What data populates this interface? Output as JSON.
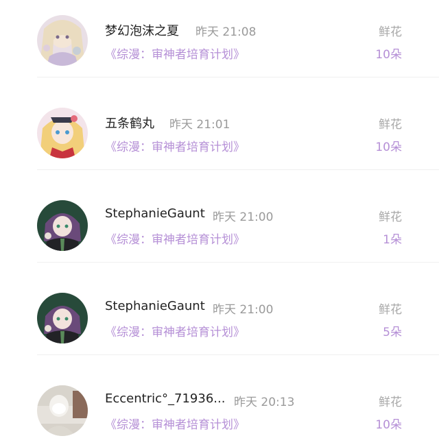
{
  "colors": {
    "name": "#222222",
    "time": "#9a9a9a",
    "accent_purple": "#b58fd6",
    "gift_label": "#a8a8a8",
    "divider": "#f0f0f0"
  },
  "records": [
    {
      "name": "梦幻泡沫之夏",
      "time": "昨天 21:08",
      "book": "《综漫：审神者培育计划》",
      "gift_label": "鲜花",
      "gift_count": "10朵",
      "avatar_icon": "anime-avatar-icon"
    },
    {
      "name": "五条鹤丸",
      "time": "昨天 21:01",
      "book": "《综漫：审神者培育计划》",
      "gift_label": "鲜花",
      "gift_count": "10朵",
      "avatar_icon": "anime-avatar-icon"
    },
    {
      "name": "StephanieGaunt",
      "time": "昨天 21:00",
      "book": "《综漫：审神者培育计划》",
      "gift_label": "鲜花",
      "gift_count": "1朵",
      "avatar_icon": "anime-avatar-icon"
    },
    {
      "name": "StephanieGaunt",
      "time": "昨天 21:00",
      "book": "《综漫：审神者培育计划》",
      "gift_label": "鲜花",
      "gift_count": "5朵",
      "avatar_icon": "anime-avatar-icon"
    },
    {
      "name": "Eccentric°_71936...",
      "time": "昨天 20:13",
      "book": "《综漫：审神者培育计划》",
      "gift_label": "鲜花",
      "gift_count": "10朵",
      "avatar_icon": "photo-avatar-icon"
    }
  ]
}
